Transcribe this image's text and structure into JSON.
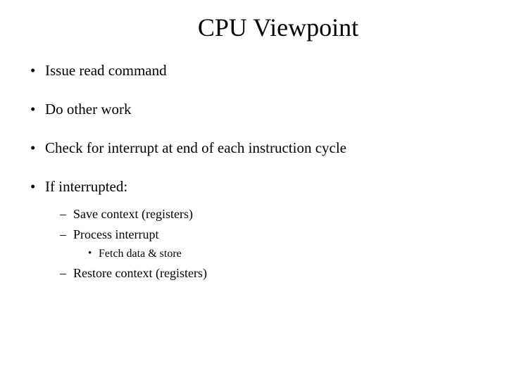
{
  "title": "CPU Viewpoint",
  "bullets": {
    "b0": "Issue read command",
    "b1": "Do other work",
    "b2": "Check for interrupt at end of each instruction cycle",
    "b3": "If interrupted:"
  },
  "sub": {
    "s0": "Save context (registers)",
    "s1": "Process interrupt",
    "s2": "Restore context (registers)"
  },
  "subsub": {
    "ss0": "Fetch data & store"
  }
}
